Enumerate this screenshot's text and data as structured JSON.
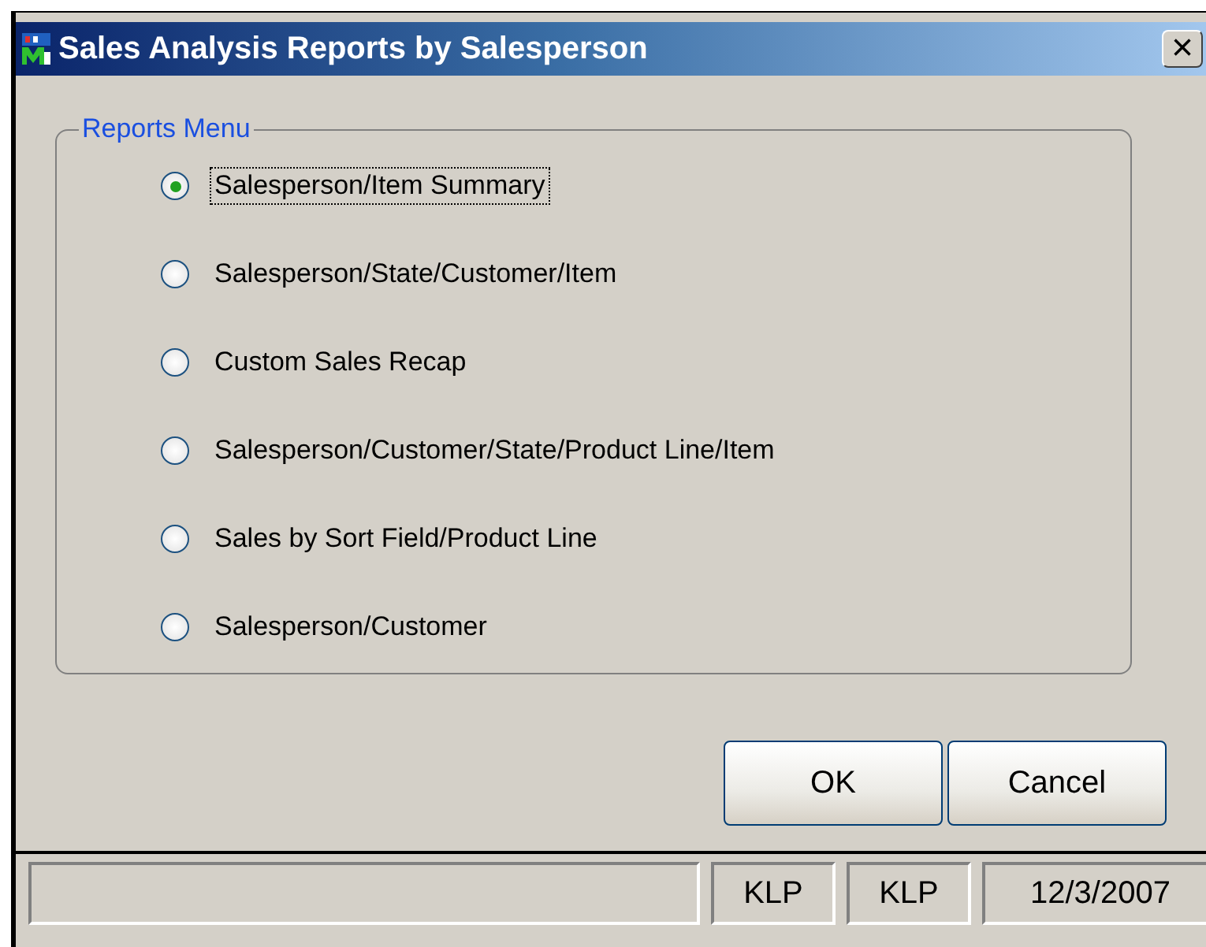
{
  "window": {
    "title": "Sales Analysis Reports by Salesperson",
    "close": "×"
  },
  "group": {
    "legend": "Reports Menu"
  },
  "options": [
    {
      "label": "Salesperson/Item Summary",
      "selected": true
    },
    {
      "label": "Salesperson/State/Customer/Item",
      "selected": false
    },
    {
      "label": "Custom Sales Recap",
      "selected": false
    },
    {
      "label": "Salesperson/Customer/State/Product Line/Item",
      "selected": false
    },
    {
      "label": "Sales by Sort Field/Product Line",
      "selected": false
    },
    {
      "label": "Salesperson/Customer",
      "selected": false
    }
  ],
  "buttons": [
    "OK",
    "Cancel"
  ],
  "status_bar": [
    "KLP",
    "KLP",
    "12/3/2007"
  ]
}
